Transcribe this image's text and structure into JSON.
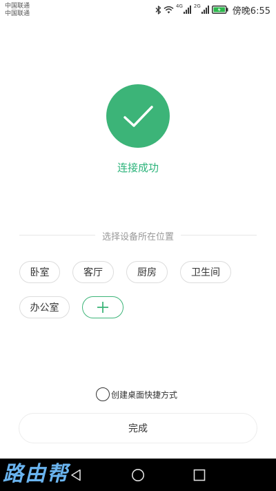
{
  "status_bar": {
    "carrier_1": "中国联通",
    "carrier_2": "中国联通",
    "network_1": "4G",
    "network_2": "2G",
    "time": "傍晚6:55",
    "battery_color": "#2db84d",
    "icons": [
      "bluetooth-icon",
      "wifi-icon",
      "signal-icon",
      "signal-icon",
      "battery-icon"
    ]
  },
  "success": {
    "icon": "check-icon",
    "circle_color": "#3cb478",
    "message": "连接成功",
    "message_color": "#2bb37a"
  },
  "location": {
    "heading": "选择设备所在位置",
    "rooms": [
      "卧室",
      "客厅",
      "厨房",
      "卫生间",
      "办公室"
    ],
    "add_icon": "plus-icon"
  },
  "shortcut": {
    "checked": false,
    "label": "创建桌面快捷方式"
  },
  "done_button": {
    "label": "完成"
  },
  "nav_bar": {
    "icons": [
      "back-icon",
      "home-icon",
      "recent-apps-icon"
    ]
  },
  "watermark": {
    "text": "路由帮",
    "color": "#6ab4ef"
  }
}
